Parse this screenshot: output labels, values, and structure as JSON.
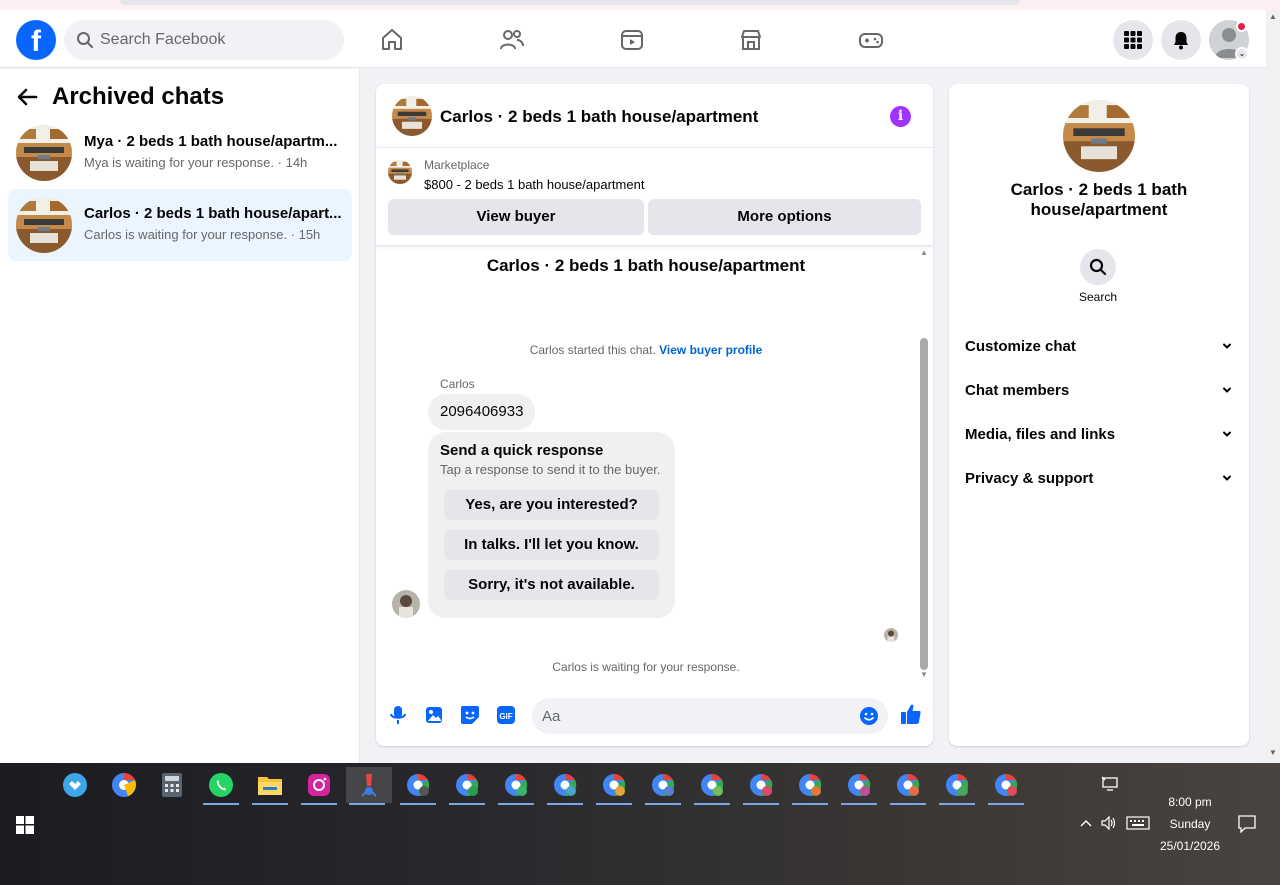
{
  "header": {
    "logo": "f",
    "search_placeholder": "Search Facebook",
    "nav": [
      "home-icon",
      "friends-icon",
      "watch-icon",
      "marketplace-icon",
      "gaming-icon"
    ],
    "right": [
      "menu-grid-icon",
      "notifications-icon",
      "profile-avatar"
    ]
  },
  "sidebar": {
    "title": "Archived chats",
    "chats": [
      {
        "name": "Mya · 2 beds 1 bath house/apartm...",
        "status": "Mya is waiting for your response.",
        "time": " · 14h"
      },
      {
        "name": "Carlos · 2 beds 1 bath house/apart...",
        "status": "Carlos is waiting for your response.",
        "time": " · 15h",
        "active": true
      }
    ]
  },
  "conversation": {
    "title": "Carlos · 2 beds 1 bath house/apartment",
    "marketplace": {
      "label": "Marketplace",
      "listing": "$800 - 2 beds 1 bath house/apartment",
      "view_buyer": "View buyer",
      "more_options": "More options"
    },
    "center_title": "Carlos · 2 beds 1 bath house/apartment",
    "started_text": "Carlos started this chat. ",
    "started_link": "View buyer profile",
    "sender": "Carlos",
    "message": "2096406933",
    "quick_response": {
      "heading": "Send a quick response",
      "sub": "Tap a response to send it to the buyer.",
      "options": [
        "Yes, are you interested?",
        "In talks. I'll let you know.",
        "Sorry, it's not available."
      ]
    },
    "waiting": "Carlos is waiting for your response.",
    "composer_placeholder": "Aa"
  },
  "details": {
    "title": "Carlos · 2 beds 1 bath house/apartment",
    "search_label": "Search",
    "sections": [
      "Customize chat",
      "Chat members",
      "Media, files and links",
      "Privacy & support"
    ]
  },
  "taskbar": {
    "time": "8:00 pm",
    "day": "Sunday",
    "date": "25/01/2026"
  },
  "colors": {
    "brand": "#0866ff",
    "accent": "#a033ff",
    "active_chat": "#ebf5ff"
  }
}
